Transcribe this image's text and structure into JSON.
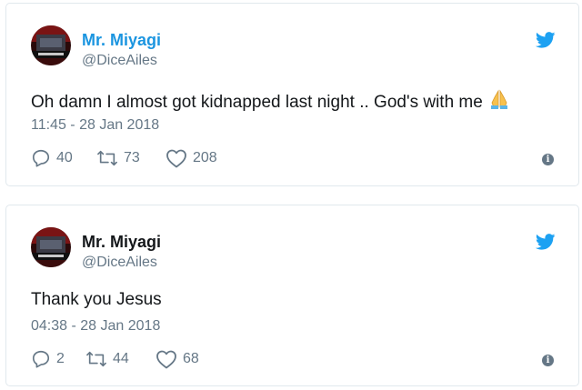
{
  "colors": {
    "name_blue": "#1da1f2",
    "text": "#14171a",
    "muted": "#657786",
    "border": "#e1e8ed"
  },
  "tweets": [
    {
      "name": "Mr. Miyagi",
      "handle": "@DiceAiles",
      "text": "Oh damn I almost got kidnapped last night .. God's with me",
      "has_emoji": true,
      "emoji_icon": "folded-hands-emoji",
      "timestamp": "11:45 - 28 Jan 2018",
      "replies": "40",
      "retweets": "73",
      "likes": "208",
      "name_color": "#1b95e0"
    },
    {
      "name": "Mr. Miyagi",
      "handle": "@DiceAiles",
      "text": "Thank you Jesus",
      "has_emoji": false,
      "timestamp": "04:38 - 28 Jan 2018",
      "replies": "2",
      "retweets": "44",
      "likes": "68",
      "name_color": "#14171a"
    }
  ],
  "icons": {
    "logo": "twitter-bird-icon",
    "reply": "reply-icon",
    "retweet": "retweet-icon",
    "like": "heart-icon",
    "info": "info-icon"
  }
}
